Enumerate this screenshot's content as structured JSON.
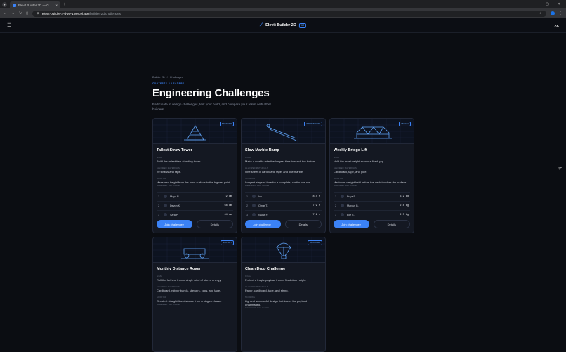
{
  "browser": {
    "tab_title": "Elevit Builder 2D — Guided B...",
    "url_domain": "elevit-builder-2-d-v0-1.vercel.app",
    "url_path": "/builder-2d/challenges"
  },
  "app": {
    "brand": "Elevit Builder 2D",
    "badge": "V2",
    "avatar": "AK"
  },
  "breadcrumb": {
    "root": "Builder 2D",
    "sep": "/",
    "current": "Challenges"
  },
  "page": {
    "eyebrow": "CONTESTS & LEADERS",
    "title": "Engineering Challenges",
    "subtitle": "Participate in design challenges, test your build, and compare your result with other builders."
  },
  "labels": {
    "goal": "Goal",
    "allowed": "Allowed materials",
    "scoring": "Scoring",
    "leaderboard": "Leaderboard",
    "updated": "Live · 3 entries"
  },
  "cards": [
    {
      "badge": "Beginner",
      "title": "Tallest Straw Tower",
      "goal": "Build the tallest free-standing tower.",
      "materials": "20 straws and tape.",
      "scoring": "Measured height from the base surface to the highest point.",
      "leaders": [
        {
          "rank": "1",
          "name": "Maya R.",
          "score": "72 cm"
        },
        {
          "rank": "2",
          "name": "Devon K.",
          "score": "68 cm"
        },
        {
          "rank": "3",
          "name": "Sara P.",
          "score": "64 cm"
        }
      ],
      "join": "Join challenge",
      "details": "Details"
    },
    {
      "badge": "Intermediate",
      "title": "Slow Marble Ramp",
      "goal": "Make a marble take the longest time to reach the bottom.",
      "materials": "One sheet of cardboard, tape, and one marble.",
      "scoring": "Longest elapsed time for a complete, continuous run.",
      "leaders": [
        {
          "rank": "1",
          "name": "Ivy L.",
          "score": "8.4 s"
        },
        {
          "rank": "2",
          "name": "Omar T.",
          "score": "7.9 s"
        },
        {
          "rank": "3",
          "name": "Nadia F.",
          "score": "7.2 s"
        }
      ],
      "join": "Join challenge",
      "details": "Details"
    },
    {
      "badge": "Weekly",
      "title": "Weekly Bridge Lift",
      "goal": "Hold the most weight across a fixed gap.",
      "materials": "Cardboard, tape, and glue.",
      "scoring": "Maximum weight held before the deck touches the surface.",
      "leaders": [
        {
          "rank": "1",
          "name": "Priya S.",
          "score": "3.2 kg"
        },
        {
          "rank": "2",
          "name": "Marcus B.",
          "score": "2.8 kg"
        },
        {
          "rank": "3",
          "name": "Elle C.",
          "score": "2.5 kg"
        }
      ],
      "join": "Join challenge",
      "details": "Details"
    },
    {
      "badge": "Monthly",
      "title": "Monthly Distance Rover",
      "goal": "Roll the farthest from a single wind of stored energy.",
      "materials": "Cardboard, rubber bands, skewers, caps, and tape.",
      "scoring": "Greatest straight-line distance from a single release."
    },
    {
      "badge": "Advanced",
      "title": "Clean Drop Challenge",
      "goal": "Protect a fragile payload from a fixed drop height.",
      "materials": "Paper, cardboard, tape, and string.",
      "scoring": "Lightest successful design that keeps the payload undamaged."
    }
  ]
}
